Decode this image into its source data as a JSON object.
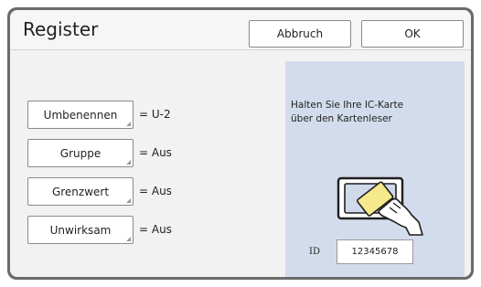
{
  "header": {
    "title": "Register",
    "cancel_label": "Abbruch",
    "ok_label": "OK"
  },
  "settings": [
    {
      "label": "Umbenennen",
      "value": "= U-2"
    },
    {
      "label": "Gruppe",
      "value": "= Aus"
    },
    {
      "label": "Grenzwert",
      "value": "= Aus"
    },
    {
      "label": "Unwirksam",
      "value": "= Aus"
    }
  ],
  "card_panel": {
    "message_line1": "Halten Sie Ihre IC-Karte",
    "message_line2": "über den Kartenleser",
    "id_label": "ID",
    "id_value": "12345678",
    "icon": "ic-card-reader-icon"
  },
  "colors": {
    "frame": "#6b6b6b",
    "screen_bg": "#f2f2f2",
    "panel_bg": "#d3dcec",
    "card_fill": "#f5e98c"
  }
}
